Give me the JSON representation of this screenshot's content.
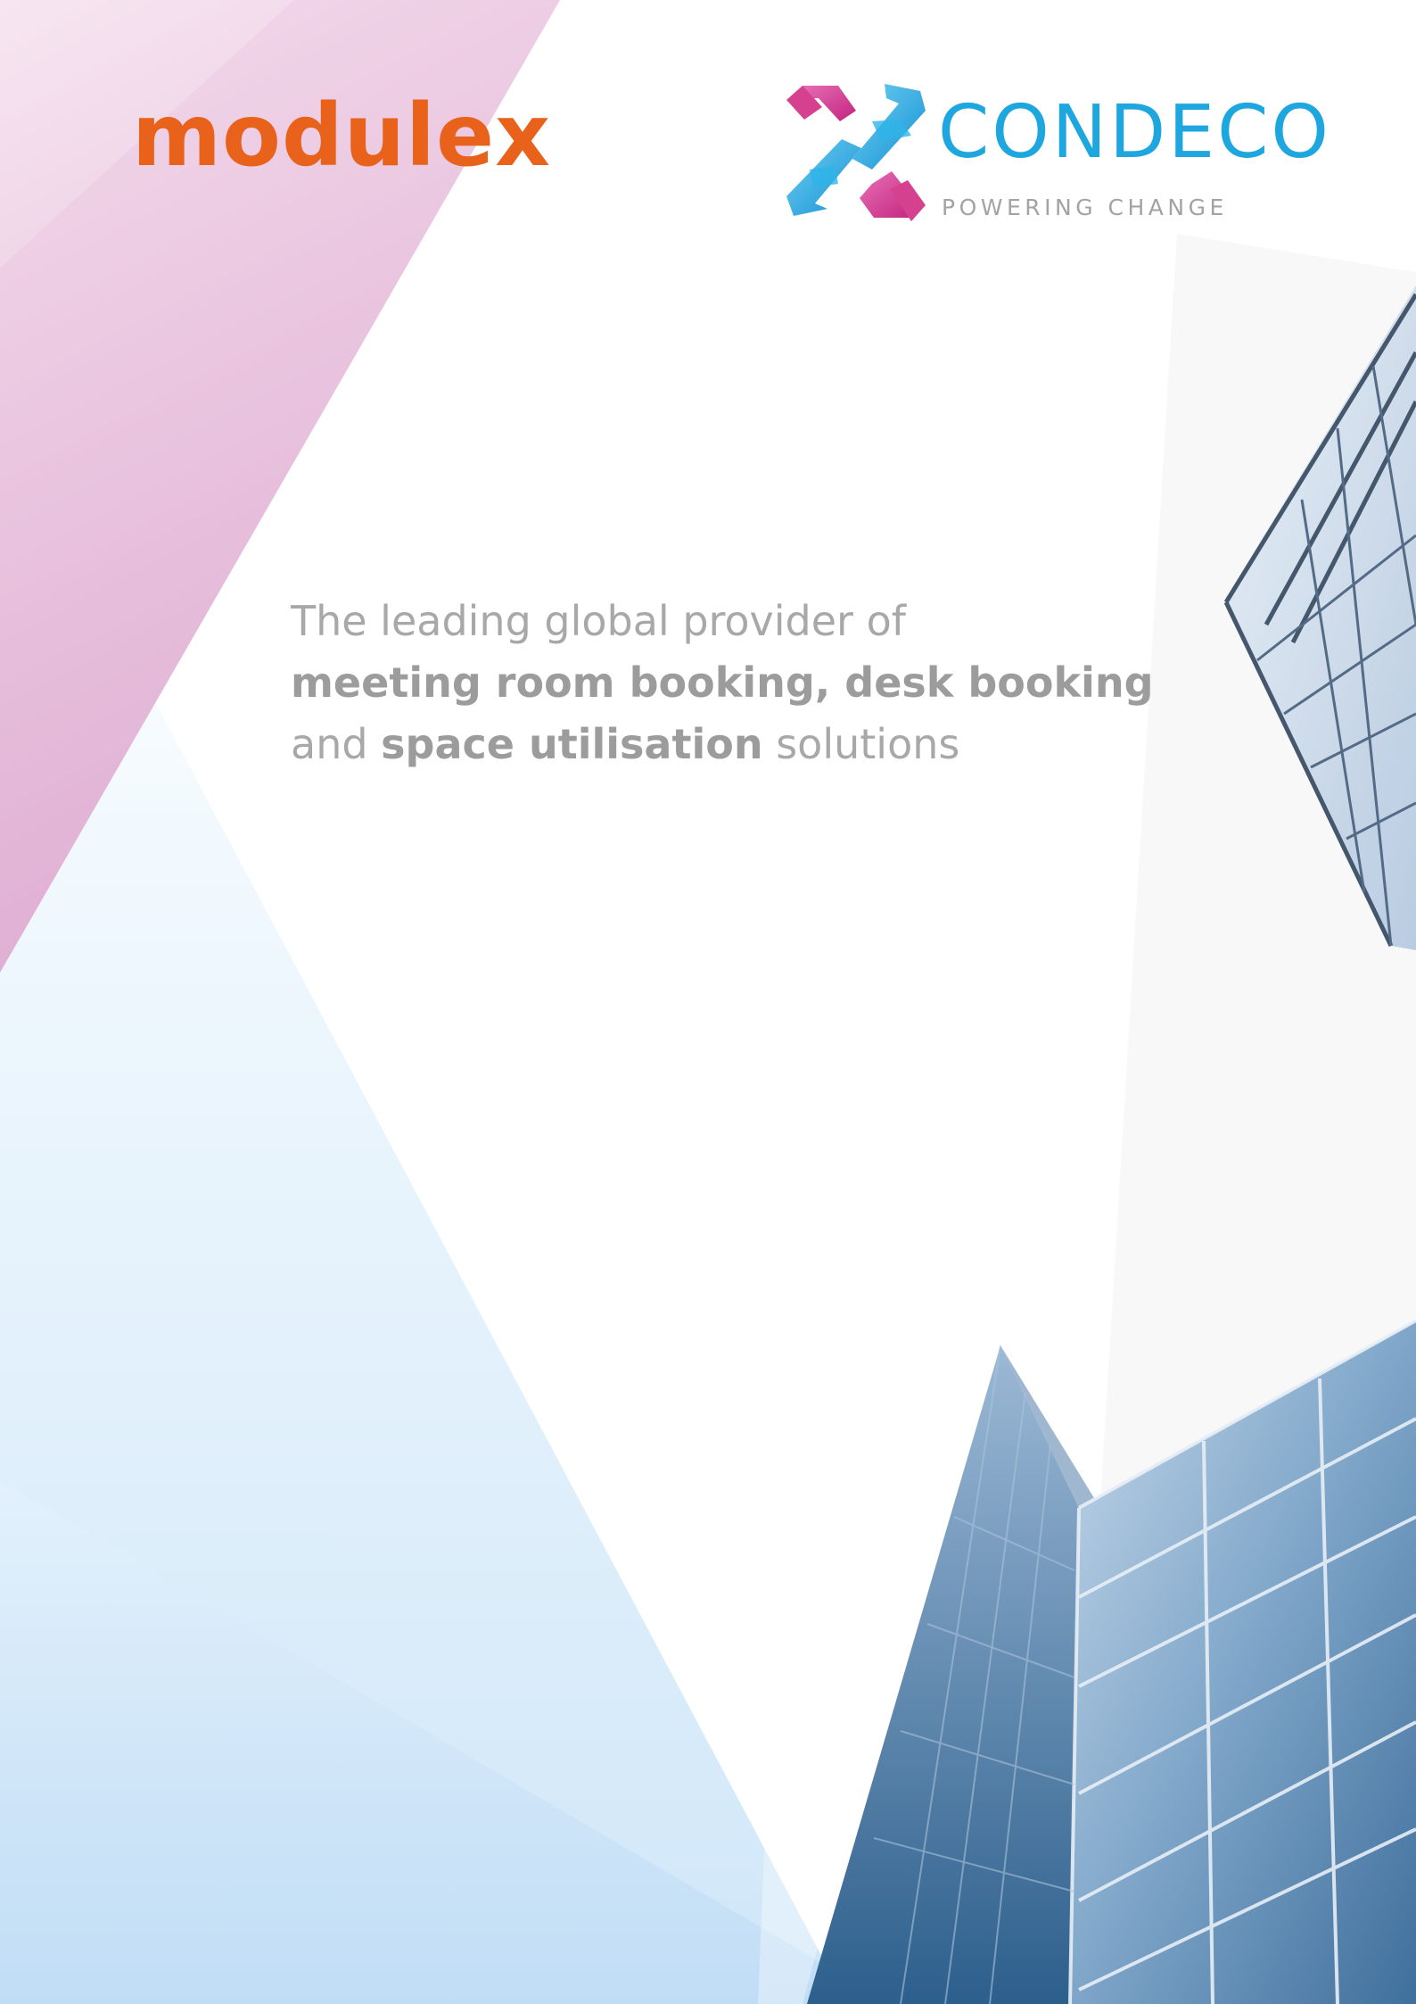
{
  "logos": {
    "modulex": "modulex",
    "condeco_name": "CONDECO",
    "condeco_tagline": "POWERING CHANGE"
  },
  "headline": {
    "line1": "The leading global provider of",
    "line2": "meeting room booking, desk booking",
    "line3_a": "and",
    "line3_b": "space utilisation",
    "line3_c": "solutions"
  },
  "colors": {
    "modulex_orange": "#e8621c",
    "condeco_blue": "#1ea6df",
    "condeco_magenta": "#d2368f",
    "headline_gray": "#a8a8a8",
    "background_pink": "#f3d6e8",
    "background_blue": "#cfe6f8"
  }
}
